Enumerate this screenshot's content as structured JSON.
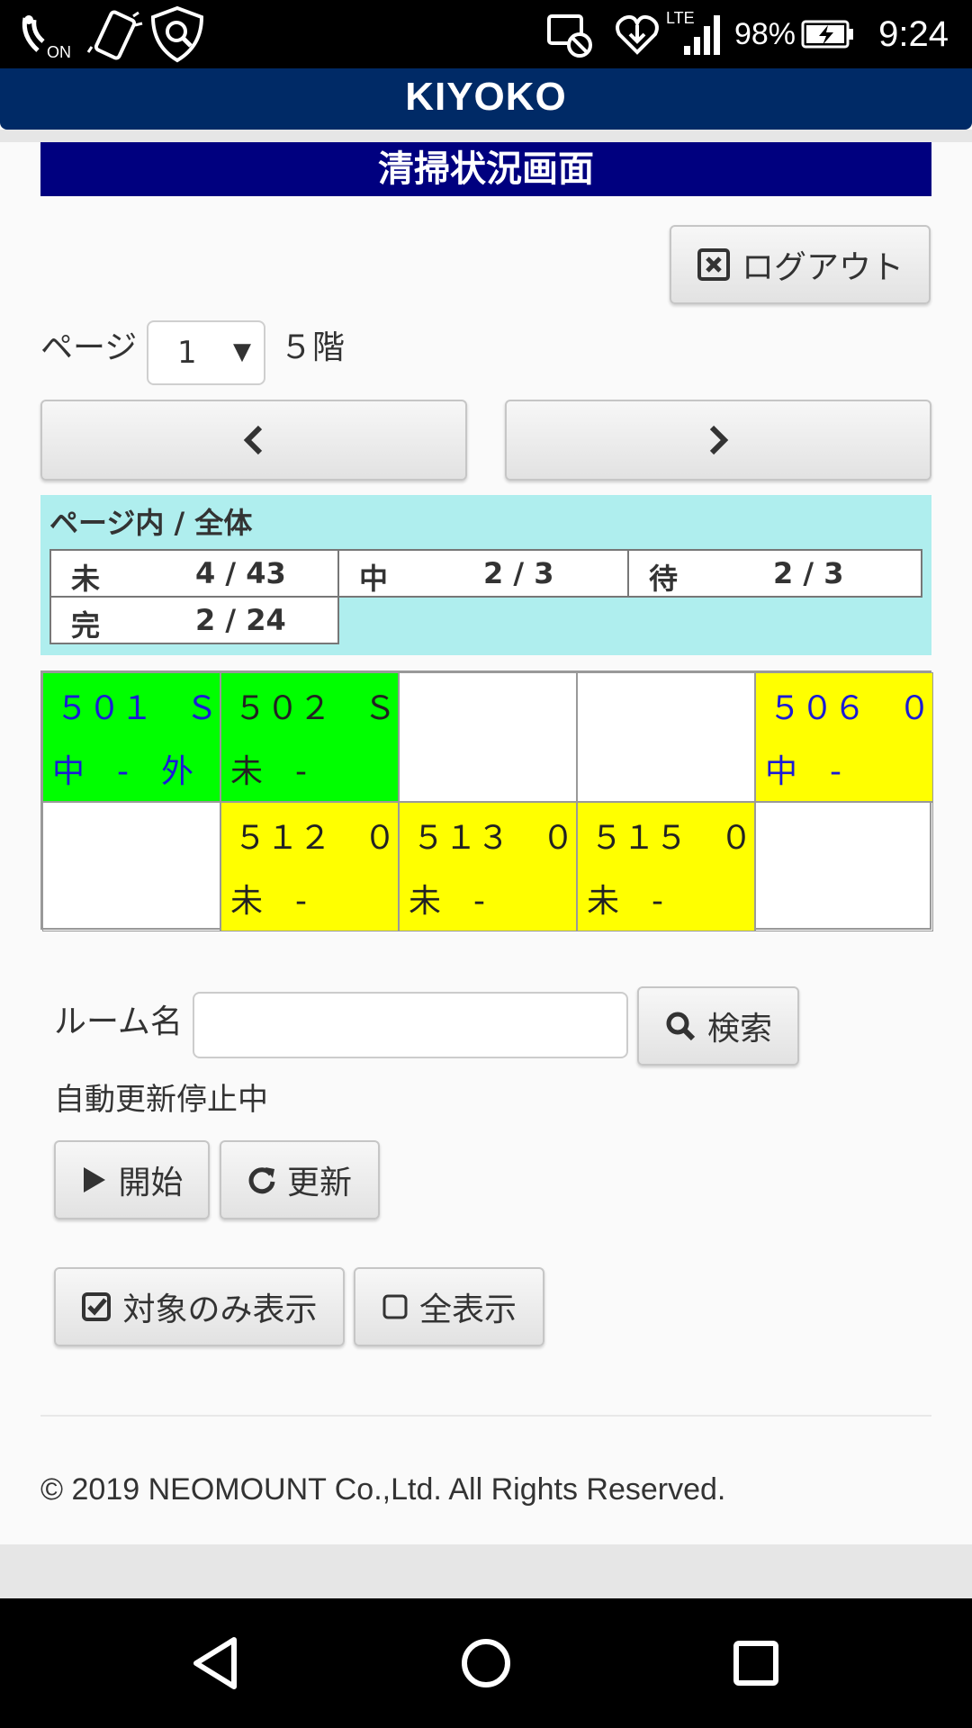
{
  "status_bar": {
    "battery": "98%",
    "time": "9:24",
    "network": "LTE"
  },
  "header": {
    "title": "KIYOKO"
  },
  "page_title": "清掃状況画面",
  "logout_label": "ログアウト",
  "pagination": {
    "label": "ページ",
    "selected_page": "1",
    "floor": "５階",
    "prev": "‹",
    "next": "›"
  },
  "summary": {
    "title": "ページ内 / 全体",
    "items": [
      {
        "key": "未",
        "value": "4 / 43"
      },
      {
        "key": "中",
        "value": "2 / 3"
      },
      {
        "key": "待",
        "value": "2 / 3"
      },
      {
        "key": "完",
        "value": "2 / 24"
      }
    ]
  },
  "rooms": [
    {
      "line1": "５０１　Ｓ",
      "line2": "中　-　外"
    },
    {
      "line1": "５０２　Ｓ",
      "line2": "未　-"
    },
    {
      "line1": "５０６　０",
      "line2": "中　-"
    },
    {
      "line1": "５１２　０",
      "line2": "未　-"
    },
    {
      "line1": "５１３　０",
      "line2": "未　-"
    },
    {
      "line1": "５１５　０",
      "line2": "未　-"
    }
  ],
  "search": {
    "label": "ルーム名",
    "value": "",
    "button": "検索"
  },
  "auto_update": {
    "status": "自動更新停止中",
    "start": "開始",
    "refresh": "更新"
  },
  "filters": {
    "target_only": "対象のみ表示",
    "show_all": "全表示"
  },
  "footer": {
    "copyright": "© 2019 NEOMOUNT Co.,Ltd. All Rights Reserved."
  },
  "colors": {
    "header_bg": "#002a66",
    "title_bg": "#00007f",
    "summary_bg": "#afeeee",
    "room_green": "#00ff00",
    "room_yellow": "#ffff00",
    "room_text_blue": "#1a1ad6"
  }
}
